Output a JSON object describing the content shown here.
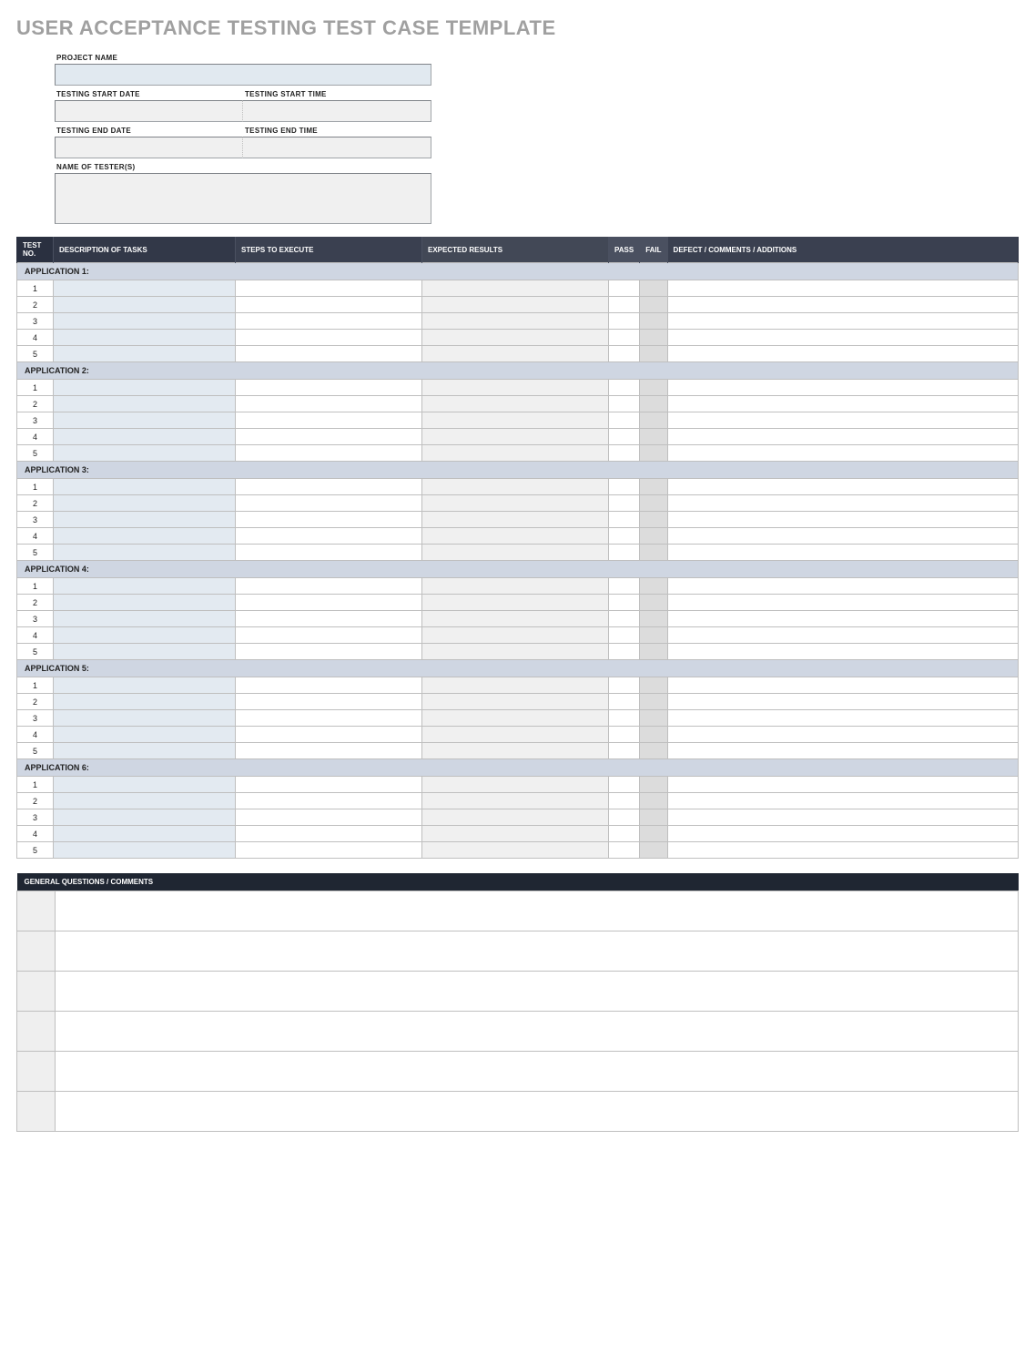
{
  "title": "USER ACCEPTANCE TESTING TEST CASE TEMPLATE",
  "meta": {
    "project_name_label": "PROJECT NAME",
    "start_date_label": "TESTING START DATE",
    "start_time_label": "TESTING START TIME",
    "end_date_label": "TESTING END DATE",
    "end_time_label": "TESTING END TIME",
    "tester_label": "NAME OF TESTER(S)",
    "project_name_value": "",
    "start_date_value": "",
    "start_time_value": "",
    "end_date_value": "",
    "end_time_value": "",
    "tester_value": ""
  },
  "table": {
    "headers": {
      "test_no": "TEST NO.",
      "desc": "DESCRIPTION OF TASKS",
      "steps": "STEPS TO EXECUTE",
      "expected": "EXPECTED RESULTS",
      "pass": "PASS",
      "fail": "FAIL",
      "defect": "DEFECT / COMMENTS / ADDITIONS"
    },
    "sections": [
      {
        "title": "APPLICATION 1:",
        "rows": [
          {
            "no": "1",
            "desc": "",
            "steps": "",
            "expected": "",
            "pass": "",
            "fail": "",
            "defect": ""
          },
          {
            "no": "2",
            "desc": "",
            "steps": "",
            "expected": "",
            "pass": "",
            "fail": "",
            "defect": ""
          },
          {
            "no": "3",
            "desc": "",
            "steps": "",
            "expected": "",
            "pass": "",
            "fail": "",
            "defect": ""
          },
          {
            "no": "4",
            "desc": "",
            "steps": "",
            "expected": "",
            "pass": "",
            "fail": "",
            "defect": ""
          },
          {
            "no": "5",
            "desc": "",
            "steps": "",
            "expected": "",
            "pass": "",
            "fail": "",
            "defect": ""
          }
        ]
      },
      {
        "title": "APPLICATION 2:",
        "rows": [
          {
            "no": "1",
            "desc": "",
            "steps": "",
            "expected": "",
            "pass": "",
            "fail": "",
            "defect": ""
          },
          {
            "no": "2",
            "desc": "",
            "steps": "",
            "expected": "",
            "pass": "",
            "fail": "",
            "defect": ""
          },
          {
            "no": "3",
            "desc": "",
            "steps": "",
            "expected": "",
            "pass": "",
            "fail": "",
            "defect": ""
          },
          {
            "no": "4",
            "desc": "",
            "steps": "",
            "expected": "",
            "pass": "",
            "fail": "",
            "defect": ""
          },
          {
            "no": "5",
            "desc": "",
            "steps": "",
            "expected": "",
            "pass": "",
            "fail": "",
            "defect": ""
          }
        ]
      },
      {
        "title": "APPLICATION 3:",
        "rows": [
          {
            "no": "1",
            "desc": "",
            "steps": "",
            "expected": "",
            "pass": "",
            "fail": "",
            "defect": ""
          },
          {
            "no": "2",
            "desc": "",
            "steps": "",
            "expected": "",
            "pass": "",
            "fail": "",
            "defect": ""
          },
          {
            "no": "3",
            "desc": "",
            "steps": "",
            "expected": "",
            "pass": "",
            "fail": "",
            "defect": ""
          },
          {
            "no": "4",
            "desc": "",
            "steps": "",
            "expected": "",
            "pass": "",
            "fail": "",
            "defect": ""
          },
          {
            "no": "5",
            "desc": "",
            "steps": "",
            "expected": "",
            "pass": "",
            "fail": "",
            "defect": ""
          }
        ]
      },
      {
        "title": "APPLICATION 4:",
        "rows": [
          {
            "no": "1",
            "desc": "",
            "steps": "",
            "expected": "",
            "pass": "",
            "fail": "",
            "defect": ""
          },
          {
            "no": "2",
            "desc": "",
            "steps": "",
            "expected": "",
            "pass": "",
            "fail": "",
            "defect": ""
          },
          {
            "no": "3",
            "desc": "",
            "steps": "",
            "expected": "",
            "pass": "",
            "fail": "",
            "defect": ""
          },
          {
            "no": "4",
            "desc": "",
            "steps": "",
            "expected": "",
            "pass": "",
            "fail": "",
            "defect": ""
          },
          {
            "no": "5",
            "desc": "",
            "steps": "",
            "expected": "",
            "pass": "",
            "fail": "",
            "defect": ""
          }
        ]
      },
      {
        "title": "APPLICATION 5:",
        "rows": [
          {
            "no": "1",
            "desc": "",
            "steps": "",
            "expected": "",
            "pass": "",
            "fail": "",
            "defect": ""
          },
          {
            "no": "2",
            "desc": "",
            "steps": "",
            "expected": "",
            "pass": "",
            "fail": "",
            "defect": ""
          },
          {
            "no": "3",
            "desc": "",
            "steps": "",
            "expected": "",
            "pass": "",
            "fail": "",
            "defect": ""
          },
          {
            "no": "4",
            "desc": "",
            "steps": "",
            "expected": "",
            "pass": "",
            "fail": "",
            "defect": ""
          },
          {
            "no": "5",
            "desc": "",
            "steps": "",
            "expected": "",
            "pass": "",
            "fail": "",
            "defect": ""
          }
        ]
      },
      {
        "title": "APPLICATION 6:",
        "rows": [
          {
            "no": "1",
            "desc": "",
            "steps": "",
            "expected": "",
            "pass": "",
            "fail": "",
            "defect": ""
          },
          {
            "no": "2",
            "desc": "",
            "steps": "",
            "expected": "",
            "pass": "",
            "fail": "",
            "defect": ""
          },
          {
            "no": "3",
            "desc": "",
            "steps": "",
            "expected": "",
            "pass": "",
            "fail": "",
            "defect": ""
          },
          {
            "no": "4",
            "desc": "",
            "steps": "",
            "expected": "",
            "pass": "",
            "fail": "",
            "defect": ""
          },
          {
            "no": "5",
            "desc": "",
            "steps": "",
            "expected": "",
            "pass": "",
            "fail": "",
            "defect": ""
          }
        ]
      }
    ]
  },
  "general_questions": {
    "header": "GENERAL QUESTIONS / COMMENTS",
    "rows": [
      {
        "id": "",
        "body": ""
      },
      {
        "id": "",
        "body": ""
      },
      {
        "id": "",
        "body": ""
      },
      {
        "id": "",
        "body": ""
      },
      {
        "id": "",
        "body": ""
      },
      {
        "id": "",
        "body": ""
      }
    ]
  }
}
